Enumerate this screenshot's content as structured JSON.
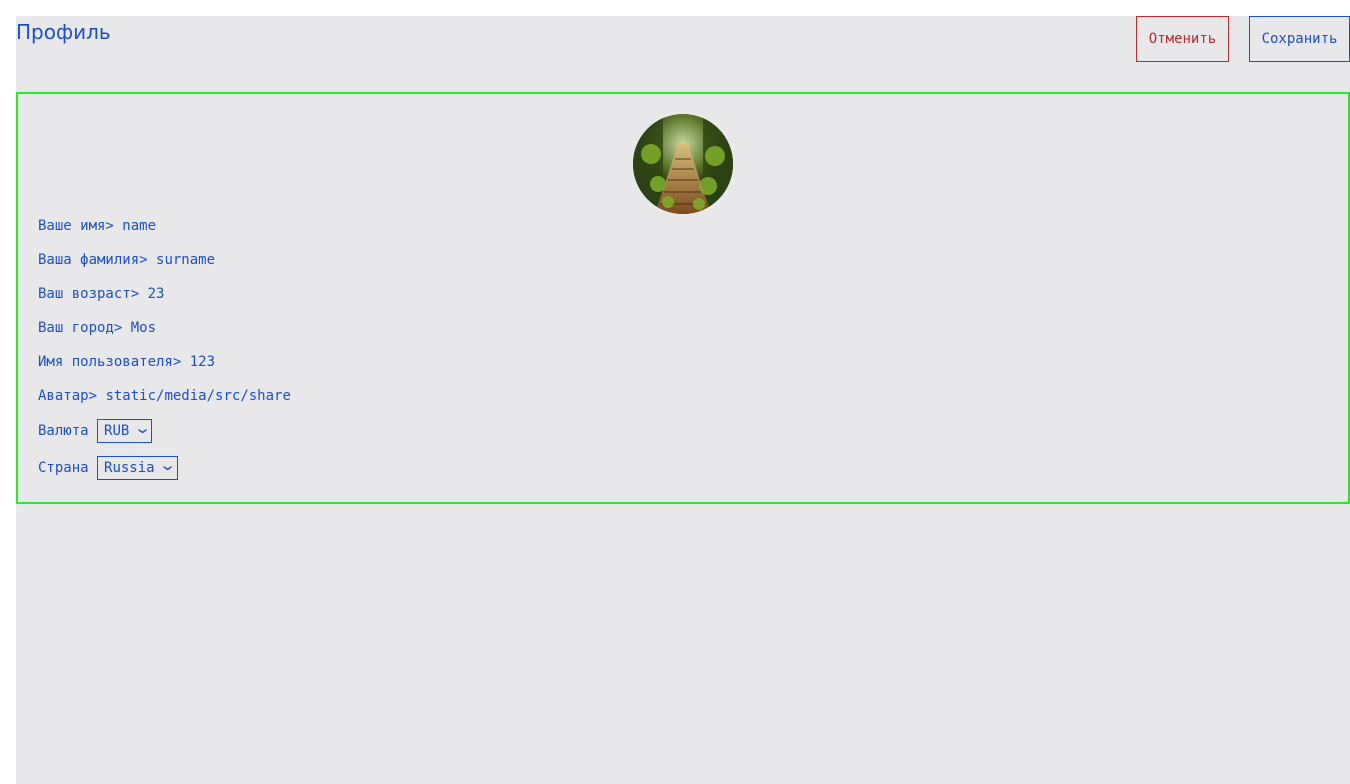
{
  "header": {
    "title": "Профиль",
    "cancel_label": "Отменить",
    "save_label": "Сохранить"
  },
  "profile": {
    "first_name": {
      "label": "Ваше имя>",
      "value": "name"
    },
    "last_name": {
      "label": "Ваша фамилия>",
      "value": "surname"
    },
    "age": {
      "label": "Ваш возраст>",
      "value": "23"
    },
    "city": {
      "label": "Ваш город>",
      "value": "Mos"
    },
    "username": {
      "label": "Имя пользователя>",
      "value": "123"
    },
    "avatar": {
      "label": "Аватар>",
      "value": "static/media/src/share"
    },
    "currency": {
      "label": "Валюта",
      "selected": "RUB"
    },
    "country": {
      "label": "Страна",
      "selected": "Russia"
    }
  },
  "icons": {
    "select_arrow": "chevron-down-icon"
  },
  "colors": {
    "text_accent": "#1a4fd0",
    "cancel": "#c0282d",
    "card_border": "#22ee22",
    "page_bg": "#e8e8ea"
  }
}
